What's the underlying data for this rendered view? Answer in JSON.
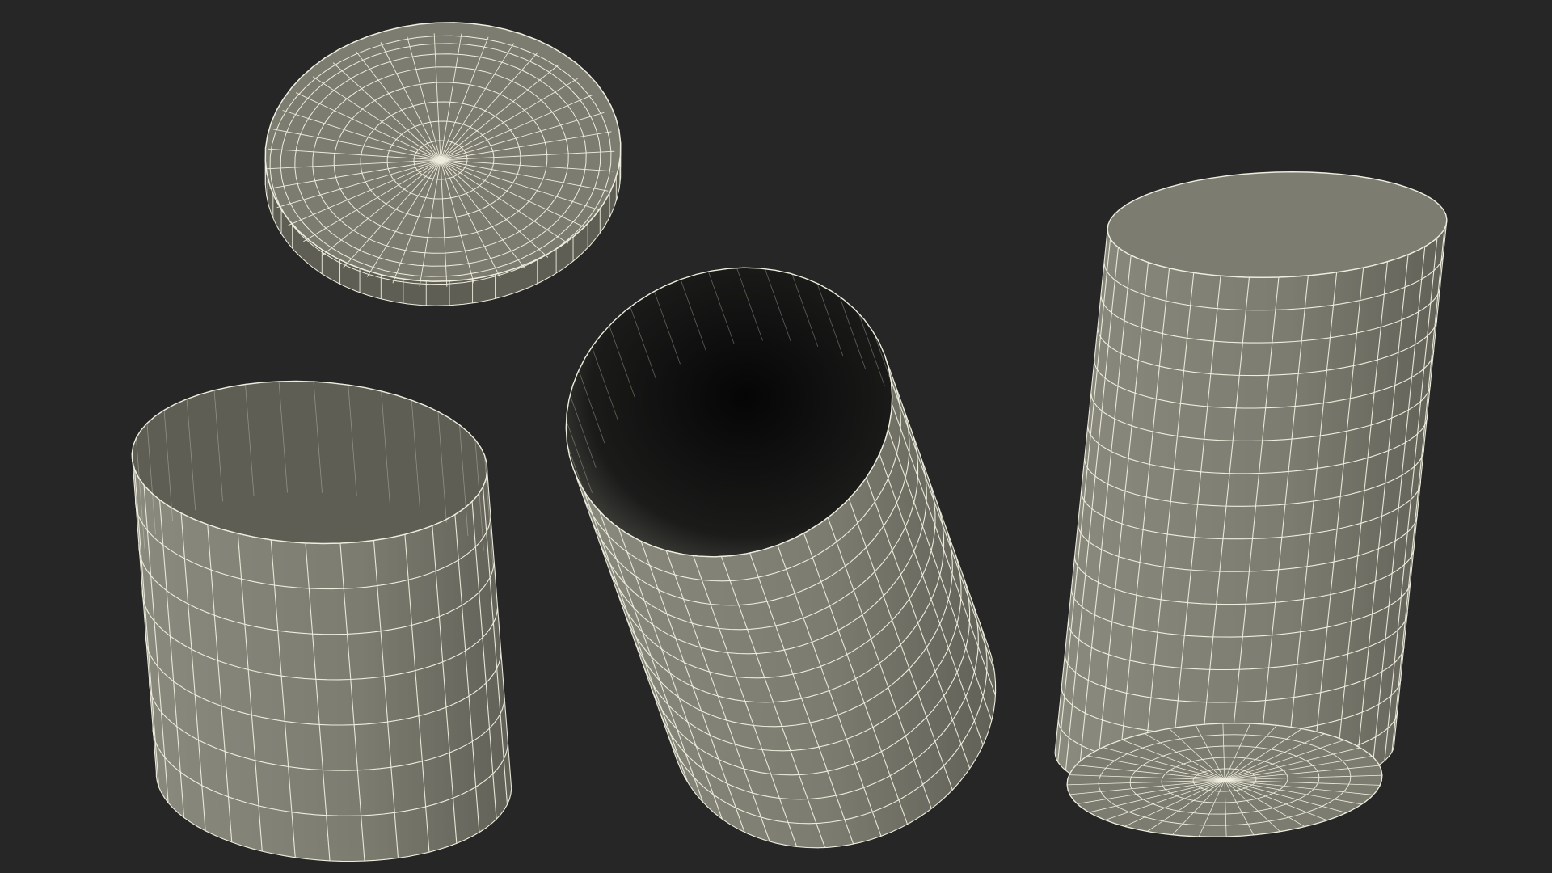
{
  "scene": {
    "background_color": "#262626",
    "surface_color": "#7c7c70",
    "surface_shadow_color": "#5e5e55",
    "wire_color": "#efeede",
    "interior_color": "#121212",
    "objects": [
      {
        "name": "jar-lid",
        "description_icon": "circle-wireframe"
      },
      {
        "name": "lid-sleeve-open-cylinder",
        "description_icon": "cylinder-wireframe"
      },
      {
        "name": "jar-body-open",
        "description_icon": "jar-wireframe"
      },
      {
        "name": "jar-body-closed",
        "description_icon": "jar-wireframe"
      }
    ]
  }
}
